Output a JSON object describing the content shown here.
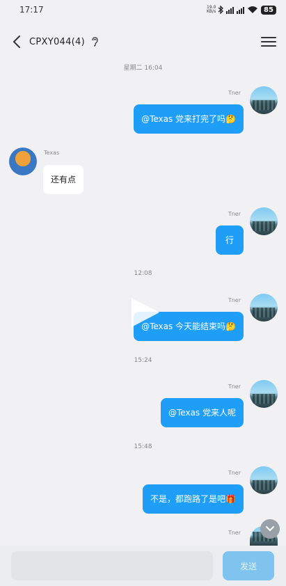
{
  "status_bar": {
    "time": "17:17",
    "net_speed": "19.0 KB/s",
    "battery": "85"
  },
  "header": {
    "title": "CPXY044(4)"
  },
  "timestamps": [
    "星期二 16:04",
    "12:08",
    "15:24",
    "15:48"
  ],
  "messages": [
    {
      "sender": "Tner",
      "text": "@Texas 党来打完了吗🤔",
      "direction": "out"
    },
    {
      "sender": "Texas",
      "text": "还有点",
      "direction": "in"
    },
    {
      "sender": "Tner",
      "text": "行",
      "direction": "out"
    },
    {
      "sender": "Tner",
      "text": "@Texas 今天能结束吗🤔",
      "direction": "out"
    },
    {
      "sender": "Tner",
      "text": "@Texas 党来人呢",
      "direction": "out"
    },
    {
      "sender": "Tner",
      "text": "不是，都跑路了是吧🎁",
      "direction": "out"
    },
    {
      "sender": "Tner",
      "text": "",
      "direction": "out"
    }
  ],
  "input": {
    "placeholder": "",
    "send_label": "发送"
  },
  "icons": {
    "back": "chevron-left-icon",
    "ear": "ear-icon",
    "menu": "menu-icon",
    "play": "play-icon",
    "scroll_down": "chevron-down-icon"
  },
  "colors": {
    "outgoing_bubble": "#1f9ef8",
    "incoming_bubble": "#ffffff",
    "background": "#f1f1f4",
    "send_button": "#7ec4ee"
  }
}
